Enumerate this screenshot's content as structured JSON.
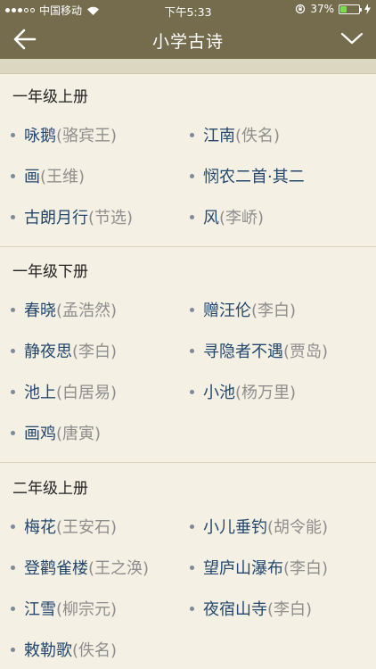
{
  "status": {
    "carrier": "中国移动",
    "time": "下午5:33",
    "battery": "37%",
    "battery_level": 0.37
  },
  "nav": {
    "title": "小学古诗"
  },
  "sections": [
    {
      "title": "一年级上册",
      "poems": [
        {
          "title": "咏鹅",
          "author": "(骆宾王)"
        },
        {
          "title": "江南",
          "author": "(佚名)"
        },
        {
          "title": "画",
          "author": "(王维)"
        },
        {
          "title": "悯农二首·其二",
          "author": ""
        },
        {
          "title": "古朗月行",
          "author": "(节选)"
        },
        {
          "title": "风",
          "author": "(李峤)"
        }
      ]
    },
    {
      "title": "一年级下册",
      "poems": [
        {
          "title": "春晓",
          "author": "(孟浩然)"
        },
        {
          "title": "赠汪伦",
          "author": "(李白)"
        },
        {
          "title": "静夜思",
          "author": "(李白)"
        },
        {
          "title": "寻隐者不遇",
          "author": "(贾岛)"
        },
        {
          "title": "池上",
          "author": "(白居易)"
        },
        {
          "title": "小池",
          "author": "(杨万里)"
        },
        {
          "title": "画鸡",
          "author": "(唐寅)"
        }
      ]
    },
    {
      "title": "二年级上册",
      "poems": [
        {
          "title": "梅花",
          "author": "(王安石)"
        },
        {
          "title": "小儿垂钓",
          "author": "(胡令能)"
        },
        {
          "title": "登鹳雀楼",
          "author": "(王之涣)"
        },
        {
          "title": "望庐山瀑布",
          "author": "(李白)"
        },
        {
          "title": "江雪",
          "author": "(柳宗元)"
        },
        {
          "title": "夜宿山寺",
          "author": "(李白)"
        },
        {
          "title": "敕勒歌",
          "author": "(佚名)"
        }
      ]
    }
  ],
  "colors": {
    "navbar": "#746c4d",
    "background": "#f4f0e3",
    "poem_title": "#23476e",
    "poem_author": "#8e8e8e"
  }
}
